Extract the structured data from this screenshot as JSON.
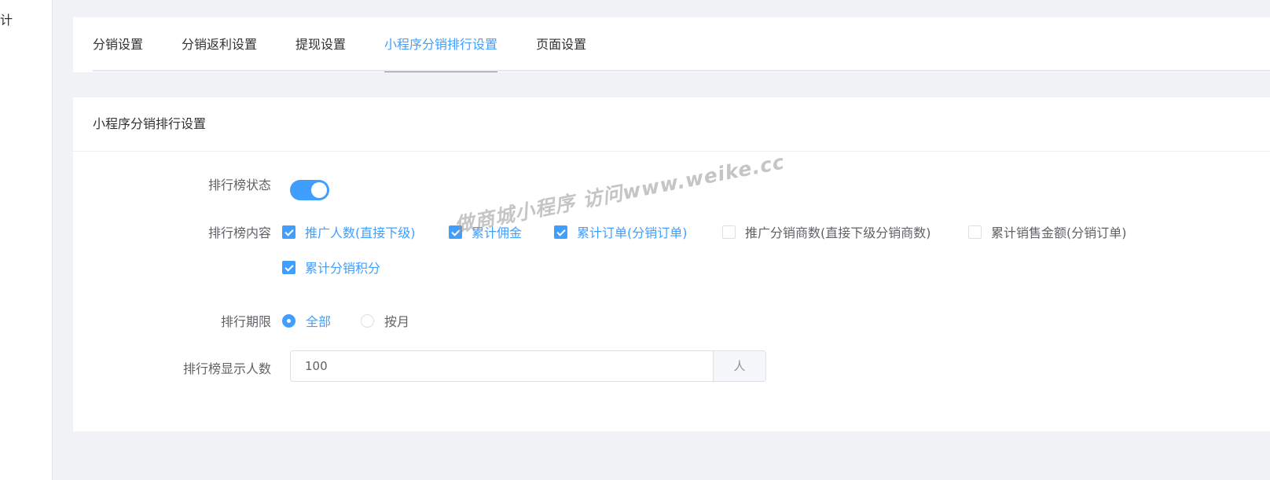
{
  "sidebar": {
    "fragment": "计"
  },
  "tabs": [
    {
      "label": "分销设置"
    },
    {
      "label": "分销返利设置"
    },
    {
      "label": "提现设置"
    },
    {
      "label": "小程序分销排行设置"
    },
    {
      "label": "页面设置"
    }
  ],
  "active_tab": 3,
  "card": {
    "title": "小程序分销排行设置"
  },
  "form": {
    "status_label": "排行榜状态",
    "status_on": true,
    "content_label": "排行榜内容",
    "content_options": [
      {
        "label": "推广人数(直接下级)",
        "checked": true
      },
      {
        "label": "累计佣金",
        "checked": true
      },
      {
        "label": "累计订单(分销订单)",
        "checked": true
      },
      {
        "label": "推广分销商数(直接下级分销商数)",
        "checked": false
      },
      {
        "label": "累计销售金额(分销订单)",
        "checked": false
      },
      {
        "label": "累计分销积分",
        "checked": true
      }
    ],
    "period_label": "排行期限",
    "period_options": [
      {
        "label": "全部",
        "checked": true
      },
      {
        "label": "按月",
        "checked": false
      }
    ],
    "count_label": "排行榜显示人数",
    "count_value": "100",
    "count_unit": "人"
  },
  "watermark": "做商城小程序 访问www.weike.cc",
  "colors": {
    "primary": "#409eff",
    "text": "#303133",
    "label": "#606266"
  }
}
